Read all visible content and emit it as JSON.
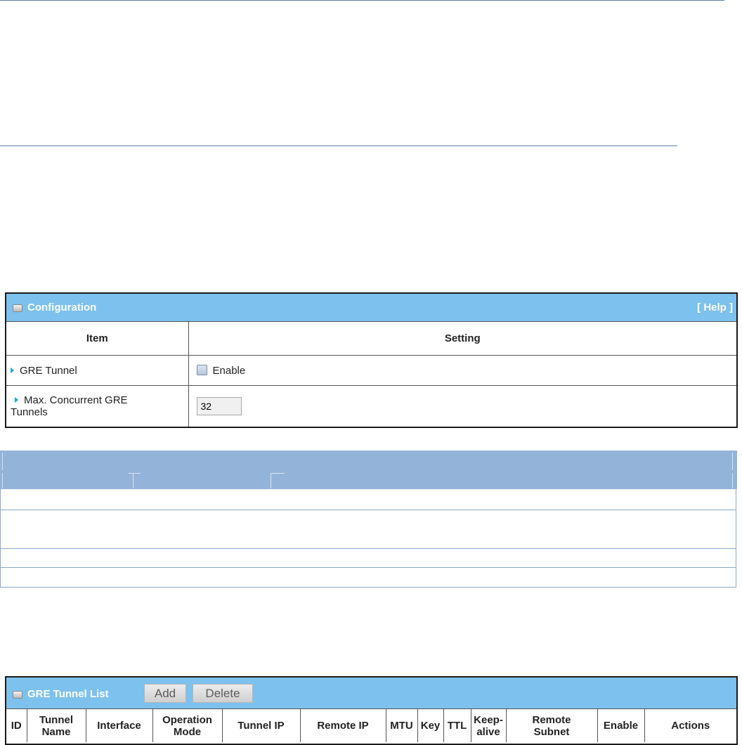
{
  "configuration": {
    "title": "Configuration",
    "help": "[ Help ]",
    "col_item": "Item",
    "col_setting": "Setting",
    "gre_tunnel_label": "GRE Tunnel",
    "gre_tunnel_enable": "Enable",
    "max_tunnels_label_line1": "Max. Concurrent GRE",
    "max_tunnels_label_line2": "Tunnels",
    "max_tunnels_value": "32"
  },
  "gre_tunnel_list": {
    "title": "GRE Tunnel List",
    "add_label": "Add",
    "delete_label": "Delete",
    "columns": [
      [
        "ID"
      ],
      [
        "Tunnel",
        "Name"
      ],
      [
        "Interface"
      ],
      [
        "Operation",
        "Mode"
      ],
      [
        "Tunnel IP"
      ],
      [
        "Remote IP"
      ],
      [
        "MTU"
      ],
      [
        "Key"
      ],
      [
        "TTL"
      ],
      [
        "Keep-",
        "alive"
      ],
      [
        "Remote",
        "Subnet"
      ],
      [
        "Enable"
      ],
      [
        "Actions"
      ]
    ]
  },
  "colors": {
    "panel_header": "#7dc1ee",
    "band": "#94b3d9",
    "rule": "#5b80a8"
  }
}
